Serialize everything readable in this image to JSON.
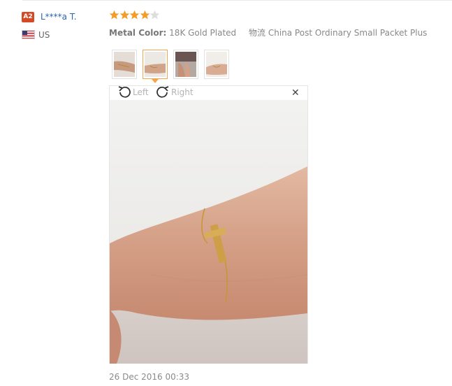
{
  "reviewer": {
    "level_badge": "A2",
    "name": "L****a T.",
    "country": "US",
    "flag_icon": "us-flag-icon"
  },
  "rating": {
    "stars": 4,
    "max": 5,
    "filled_color": "#f39c2b",
    "empty_color": "#dddddd"
  },
  "attributes": {
    "color_label": "Metal Color:",
    "color_value": "18K Gold Plated",
    "shipping_label": "物流",
    "shipping_value": "China Post Ordinary Small Packet Plus"
  },
  "thumbnails": {
    "count": 4,
    "active_index": 1
  },
  "viewer": {
    "rotate_left": "Left",
    "rotate_right": "Right",
    "close_icon": "close-icon",
    "photo_icon": "bracelet-photo"
  },
  "date": "26 Dec 2016 00:33"
}
